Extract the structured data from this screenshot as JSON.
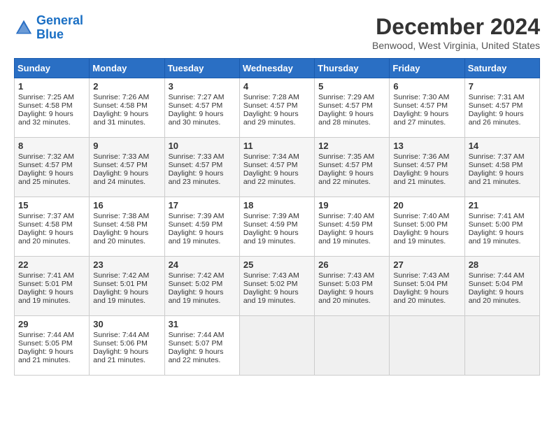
{
  "header": {
    "logo_line1": "General",
    "logo_line2": "Blue",
    "month": "December 2024",
    "location": "Benwood, West Virginia, United States"
  },
  "days_of_week": [
    "Sunday",
    "Monday",
    "Tuesday",
    "Wednesday",
    "Thursday",
    "Friday",
    "Saturday"
  ],
  "weeks": [
    [
      {
        "day": 1,
        "rise": "7:25 AM",
        "set": "4:58 PM",
        "daylight": "9 hours and 32 minutes"
      },
      {
        "day": 2,
        "rise": "7:26 AM",
        "set": "4:58 PM",
        "daylight": "9 hours and 31 minutes"
      },
      {
        "day": 3,
        "rise": "7:27 AM",
        "set": "4:57 PM",
        "daylight": "9 hours and 30 minutes"
      },
      {
        "day": 4,
        "rise": "7:28 AM",
        "set": "4:57 PM",
        "daylight": "9 hours and 29 minutes"
      },
      {
        "day": 5,
        "rise": "7:29 AM",
        "set": "4:57 PM",
        "daylight": "9 hours and 28 minutes"
      },
      {
        "day": 6,
        "rise": "7:30 AM",
        "set": "4:57 PM",
        "daylight": "9 hours and 27 minutes"
      },
      {
        "day": 7,
        "rise": "7:31 AM",
        "set": "4:57 PM",
        "daylight": "9 hours and 26 minutes"
      }
    ],
    [
      {
        "day": 8,
        "rise": "7:32 AM",
        "set": "4:57 PM",
        "daylight": "9 hours and 25 minutes"
      },
      {
        "day": 9,
        "rise": "7:33 AM",
        "set": "4:57 PM",
        "daylight": "9 hours and 24 minutes"
      },
      {
        "day": 10,
        "rise": "7:33 AM",
        "set": "4:57 PM",
        "daylight": "9 hours and 23 minutes"
      },
      {
        "day": 11,
        "rise": "7:34 AM",
        "set": "4:57 PM",
        "daylight": "9 hours and 22 minutes"
      },
      {
        "day": 12,
        "rise": "7:35 AM",
        "set": "4:57 PM",
        "daylight": "9 hours and 22 minutes"
      },
      {
        "day": 13,
        "rise": "7:36 AM",
        "set": "4:57 PM",
        "daylight": "9 hours and 21 minutes"
      },
      {
        "day": 14,
        "rise": "7:37 AM",
        "set": "4:58 PM",
        "daylight": "9 hours and 21 minutes"
      }
    ],
    [
      {
        "day": 15,
        "rise": "7:37 AM",
        "set": "4:58 PM",
        "daylight": "9 hours and 20 minutes"
      },
      {
        "day": 16,
        "rise": "7:38 AM",
        "set": "4:58 PM",
        "daylight": "9 hours and 20 minutes"
      },
      {
        "day": 17,
        "rise": "7:39 AM",
        "set": "4:59 PM",
        "daylight": "9 hours and 19 minutes"
      },
      {
        "day": 18,
        "rise": "7:39 AM",
        "set": "4:59 PM",
        "daylight": "9 hours and 19 minutes"
      },
      {
        "day": 19,
        "rise": "7:40 AM",
        "set": "4:59 PM",
        "daylight": "9 hours and 19 minutes"
      },
      {
        "day": 20,
        "rise": "7:40 AM",
        "set": "5:00 PM",
        "daylight": "9 hours and 19 minutes"
      },
      {
        "day": 21,
        "rise": "7:41 AM",
        "set": "5:00 PM",
        "daylight": "9 hours and 19 minutes"
      }
    ],
    [
      {
        "day": 22,
        "rise": "7:41 AM",
        "set": "5:01 PM",
        "daylight": "9 hours and 19 minutes"
      },
      {
        "day": 23,
        "rise": "7:42 AM",
        "set": "5:01 PM",
        "daylight": "9 hours and 19 minutes"
      },
      {
        "day": 24,
        "rise": "7:42 AM",
        "set": "5:02 PM",
        "daylight": "9 hours and 19 minutes"
      },
      {
        "day": 25,
        "rise": "7:43 AM",
        "set": "5:02 PM",
        "daylight": "9 hours and 19 minutes"
      },
      {
        "day": 26,
        "rise": "7:43 AM",
        "set": "5:03 PM",
        "daylight": "9 hours and 20 minutes"
      },
      {
        "day": 27,
        "rise": "7:43 AM",
        "set": "5:04 PM",
        "daylight": "9 hours and 20 minutes"
      },
      {
        "day": 28,
        "rise": "7:44 AM",
        "set": "5:04 PM",
        "daylight": "9 hours and 20 minutes"
      }
    ],
    [
      {
        "day": 29,
        "rise": "7:44 AM",
        "set": "5:05 PM",
        "daylight": "9 hours and 21 minutes"
      },
      {
        "day": 30,
        "rise": "7:44 AM",
        "set": "5:06 PM",
        "daylight": "9 hours and 21 minutes"
      },
      {
        "day": 31,
        "rise": "7:44 AM",
        "set": "5:07 PM",
        "daylight": "9 hours and 22 minutes"
      },
      null,
      null,
      null,
      null
    ]
  ]
}
